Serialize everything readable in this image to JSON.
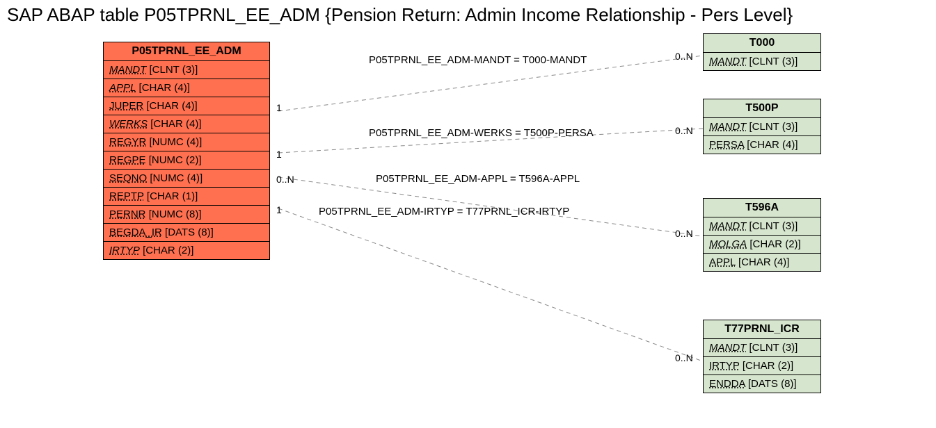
{
  "title": "SAP ABAP table P05TPRNL_EE_ADM {Pension Return: Admin Income Relationship - Pers Level}",
  "main_entity": {
    "name": "P05TPRNL_EE_ADM",
    "fields": [
      {
        "name": "MANDT",
        "type": "[CLNT (3)]",
        "italic": true
      },
      {
        "name": "APPL",
        "type": "[CHAR (4)]",
        "italic": true
      },
      {
        "name": "JUPER",
        "type": "[CHAR (4)]",
        "italic": false
      },
      {
        "name": "WERKS",
        "type": "[CHAR (4)]",
        "italic": true
      },
      {
        "name": "REGYR",
        "type": "[NUMC (4)]",
        "italic": false
      },
      {
        "name": "REGPE",
        "type": "[NUMC (2)]",
        "italic": false
      },
      {
        "name": "SEQNO",
        "type": "[NUMC (4)]",
        "italic": false
      },
      {
        "name": "REPTP",
        "type": "[CHAR (1)]",
        "italic": false
      },
      {
        "name": "PERNR",
        "type": "[NUMC (8)]",
        "italic": false
      },
      {
        "name": "BEGDA_IR",
        "type": "[DATS (8)]",
        "italic": false
      },
      {
        "name": "IRTYP",
        "type": "[CHAR (2)]",
        "italic": true
      }
    ]
  },
  "ref_entities": [
    {
      "id": "t000",
      "name": "T000",
      "fields": [
        {
          "name": "MANDT",
          "type": "[CLNT (3)]",
          "italic": true
        }
      ]
    },
    {
      "id": "t500p",
      "name": "T500P",
      "fields": [
        {
          "name": "MANDT",
          "type": "[CLNT (3)]",
          "italic": true
        },
        {
          "name": "PERSA",
          "type": "[CHAR (4)]",
          "italic": false
        }
      ]
    },
    {
      "id": "t596a",
      "name": "T596A",
      "fields": [
        {
          "name": "MANDT",
          "type": "[CLNT (3)]",
          "italic": true
        },
        {
          "name": "MOLGA",
          "type": "[CHAR (2)]",
          "italic": true
        },
        {
          "name": "APPL",
          "type": "[CHAR (4)]",
          "italic": false
        }
      ]
    },
    {
      "id": "t77prnl_icr",
      "name": "T77PRNL_ICR",
      "fields": [
        {
          "name": "MANDT",
          "type": "[CLNT (3)]",
          "italic": true
        },
        {
          "name": "IRTYP",
          "type": "[CHAR (2)]",
          "italic": false
        },
        {
          "name": "ENDDA",
          "type": "[DATS (8)]",
          "italic": false
        }
      ]
    }
  ],
  "relations": [
    {
      "label": "P05TPRNL_EE_ADM-MANDT = T000-MANDT",
      "left_card": "1",
      "right_card": "0..N"
    },
    {
      "label": "P05TPRNL_EE_ADM-WERKS = T500P-PERSA",
      "left_card": "1",
      "right_card": "0..N"
    },
    {
      "label": "P05TPRNL_EE_ADM-APPL = T596A-APPL",
      "left_card": "0..N",
      "right_card": "0..N"
    },
    {
      "label": "P05TPRNL_EE_ADM-IRTYP = T77PRNL_ICR-IRTYP",
      "left_card": "1",
      "right_card": "0..N"
    }
  ]
}
